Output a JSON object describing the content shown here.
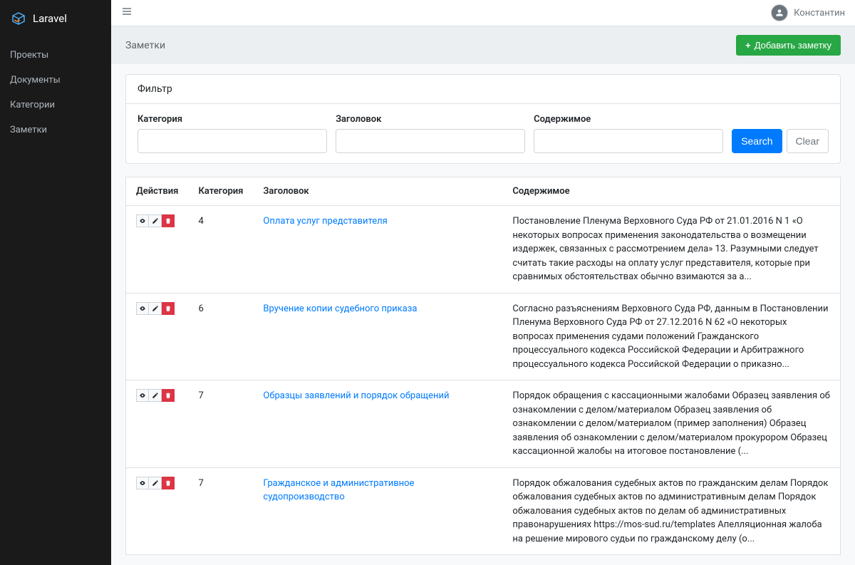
{
  "brand": "Laravel",
  "sidebar": {
    "items": [
      {
        "label": "Проекты"
      },
      {
        "label": "Документы"
      },
      {
        "label": "Категории"
      },
      {
        "label": "Заметки"
      }
    ]
  },
  "user": {
    "name": "Константин"
  },
  "page": {
    "title": "Заметки",
    "add_button": "Добавить заметку"
  },
  "filter": {
    "title": "Фильтр",
    "category_label": "Категория",
    "title_label": "Заголовок",
    "content_label": "Содержимое",
    "search_label": "Search",
    "clear_label": "Clear"
  },
  "table": {
    "headers": {
      "actions": "Действия",
      "category": "Категория",
      "title": "Заголовок",
      "content": "Содержимое"
    },
    "rows": [
      {
        "category": "4",
        "title": "Оплата услуг представителя",
        "content": "Постановление Пленума Верховного Суда РФ от 21.01.2016 N 1 «О некоторых вопросах применения законодательства о возмещении издержек, связанных с рассмотрением дела» 13. Разумными следует считать такие расходы на оплату услуг представителя, которые при сравнимых обстоятельствах обычно взимаются за а..."
      },
      {
        "category": "6",
        "title": "Вручение копии судебного приказа",
        "content": "Согласно разъяснениям Верховного Суда РФ, данным в Постановлении Пленума Верховного Суда РФ от 27.12.2016 N 62 «О некоторых вопросах применения судами положений Гражданского процессуального кодекса Российской Федерации и Арбитражного процессуального кодекса Российской Федерации о приказно..."
      },
      {
        "category": "7",
        "title": "Образцы заявлений и порядок обращений",
        "content": "Порядок обращения с кассационными жалобами   Образец заявления об ознакомлении с делом/материалом Образец заявления об ознакомлении с делом/материалом (пример заполнения) Образец заявления об ознакомлении с делом/материалом прокурором Образец кассационной жалобы на итоговое постановление (..."
      },
      {
        "category": "7",
        "title": "Гражданское и административное судопроизводство",
        "content": "Порядок обжалования судебных актов по гражданским делам Порядок обжалования судебных актов по административным делам Порядок обжалования судебных актов по делам об административных правонарушениях https://mos-sud.ru/templates Апелляционная жалоба на решение мирового судьи по гражданскому делу (о..."
      }
    ]
  }
}
